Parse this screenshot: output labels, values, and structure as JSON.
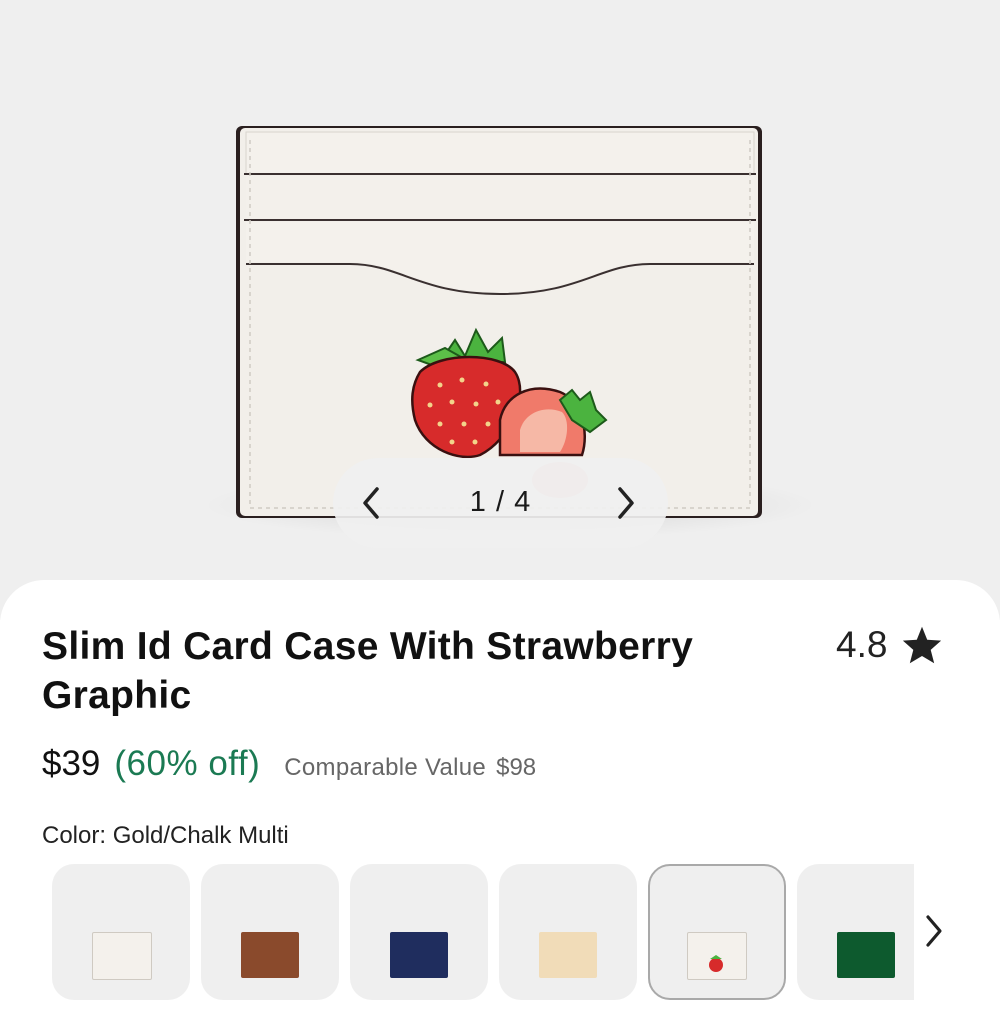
{
  "gallery": {
    "counter": "1 / 4",
    "prev_icon": "chevron-left-icon",
    "next_icon": "chevron-right-icon"
  },
  "product": {
    "title": "Slim Id Card Case With Strawberry Graphic",
    "rating": "4.8",
    "rating_icon": "star-icon",
    "price": "$39",
    "discount": "(60% off)",
    "comparable_label": "Comparable Value",
    "comparable_value": "$98"
  },
  "color": {
    "label": "Color: Gold/Chalk Multi",
    "swatches": [
      {
        "name": "chalk",
        "color": "#f4f1ec",
        "selected": false
      },
      {
        "name": "brown",
        "color": "#8a4a2c",
        "selected": false
      },
      {
        "name": "navy",
        "color": "#1f2d5e",
        "selected": false
      },
      {
        "name": "tan-lemon",
        "color": "#f1dcb8",
        "selected": false
      },
      {
        "name": "chalk-strawberry",
        "color": "#f4f1ec",
        "selected": true
      },
      {
        "name": "green",
        "color": "#0d5a2e",
        "selected": false
      }
    ],
    "next_icon": "chevron-right-icon"
  },
  "colors": {
    "discount": "#1b7a53",
    "background": "#efefef"
  }
}
